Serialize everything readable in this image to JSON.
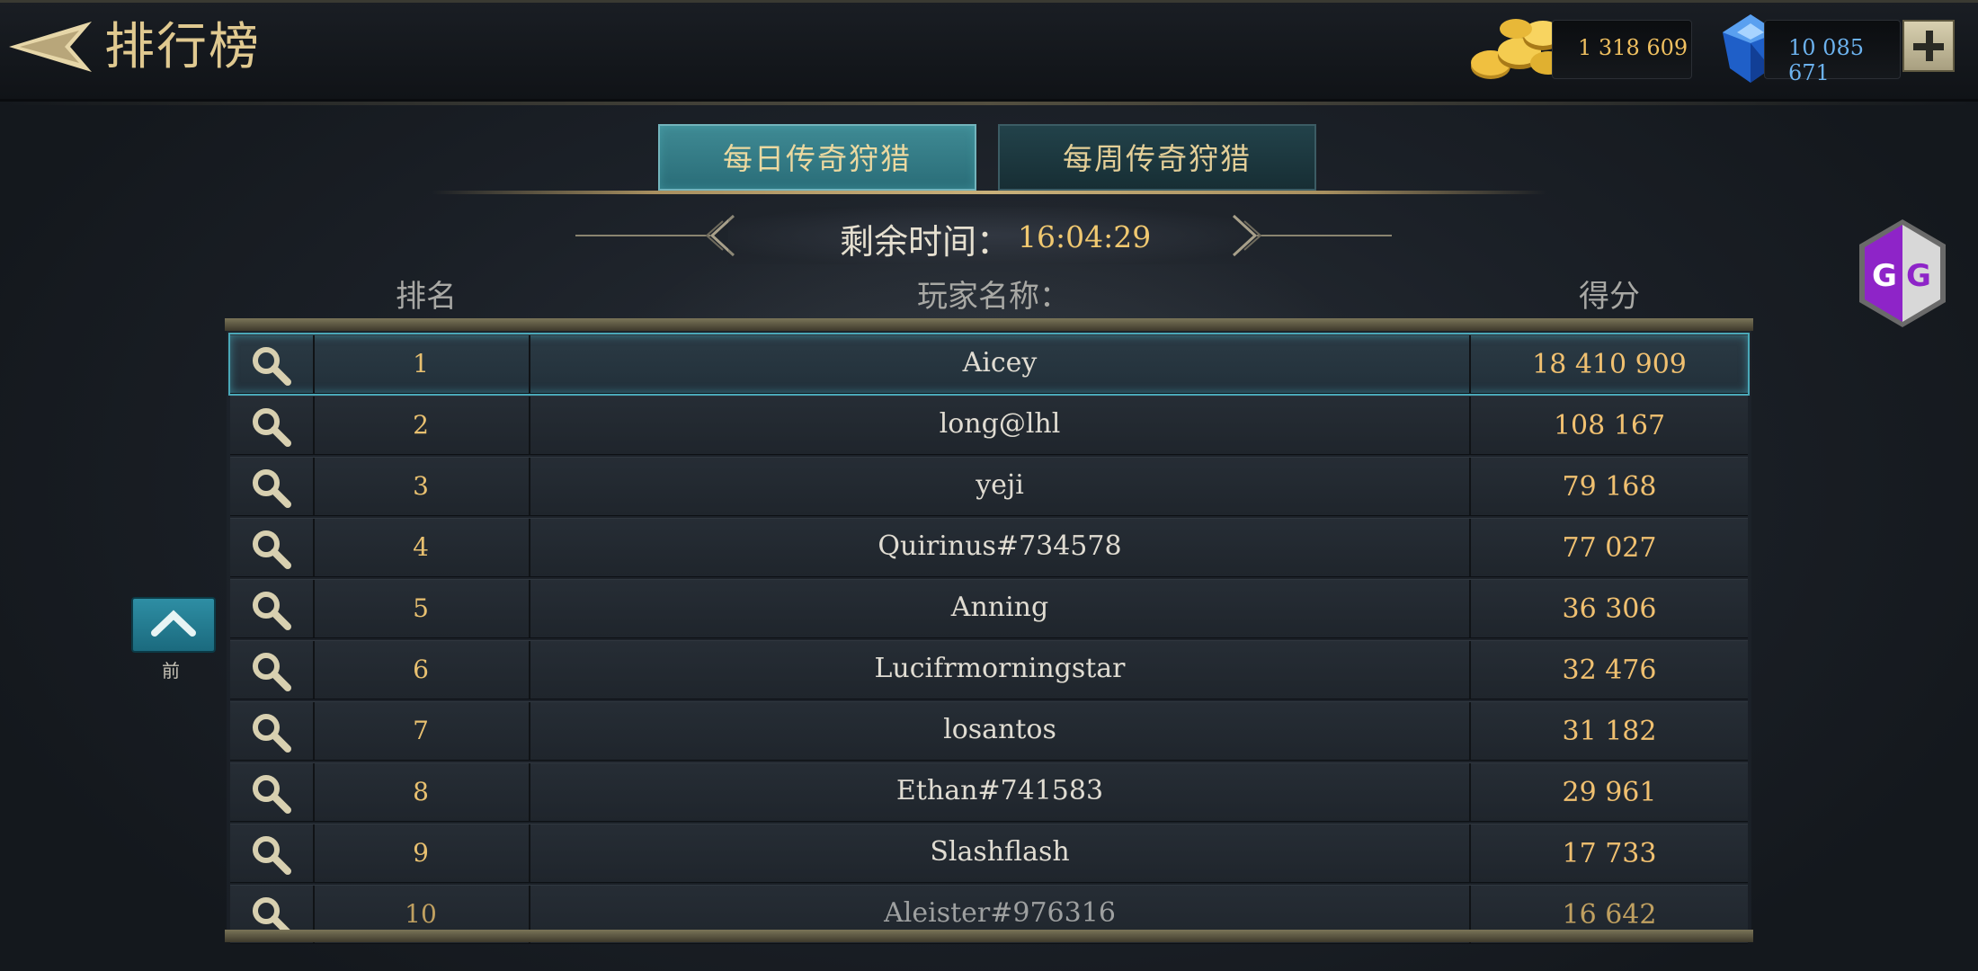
{
  "header": {
    "title": "排行榜",
    "back_icon": "arrow-left-icon"
  },
  "currency": {
    "coins": "1 318 609",
    "gems": "10 085 671",
    "coin_icon": "gold-coins-icon",
    "gem_icon": "blue-gem-icon",
    "plus_icon": "plus-icon"
  },
  "tabs": {
    "daily": "每日传奇狩猎",
    "weekly": "每周传奇狩猎"
  },
  "timer": {
    "label": "剩余时间：",
    "value": "16:04:29"
  },
  "table": {
    "headers": {
      "rank": "排名",
      "name": "玩家名称：",
      "score": "得分"
    },
    "rows": [
      {
        "rank": "1",
        "name": "Aicey",
        "score": "18 410 909"
      },
      {
        "rank": "2",
        "name": "long@lhl",
        "score": "108 167"
      },
      {
        "rank": "3",
        "name": "yeji",
        "score": "79 168"
      },
      {
        "rank": "4",
        "name": "Quirinus#734578",
        "score": "77 027"
      },
      {
        "rank": "5",
        "name": "Anning",
        "score": "36 306"
      },
      {
        "rank": "6",
        "name": "Lucifrmorningstar",
        "score": "32 476"
      },
      {
        "rank": "7",
        "name": "losantos",
        "score": "31 182"
      },
      {
        "rank": "8",
        "name": "Ethan#741583",
        "score": "29 961"
      },
      {
        "rank": "9",
        "name": "Slashflash",
        "score": "17 733"
      },
      {
        "rank": "10",
        "name": "Aleister#976316",
        "score": "16 642"
      }
    ],
    "row_icon": "magnifier-icon"
  },
  "side": {
    "up_label": "前",
    "up_icon": "chevron-up-icon"
  },
  "overlay": {
    "gg_icon": "game-guardian-icon"
  },
  "colors": {
    "accent_gold": "#f0c070",
    "accent_teal": "#3f8a94",
    "gem_blue": "#6cb2ee"
  }
}
